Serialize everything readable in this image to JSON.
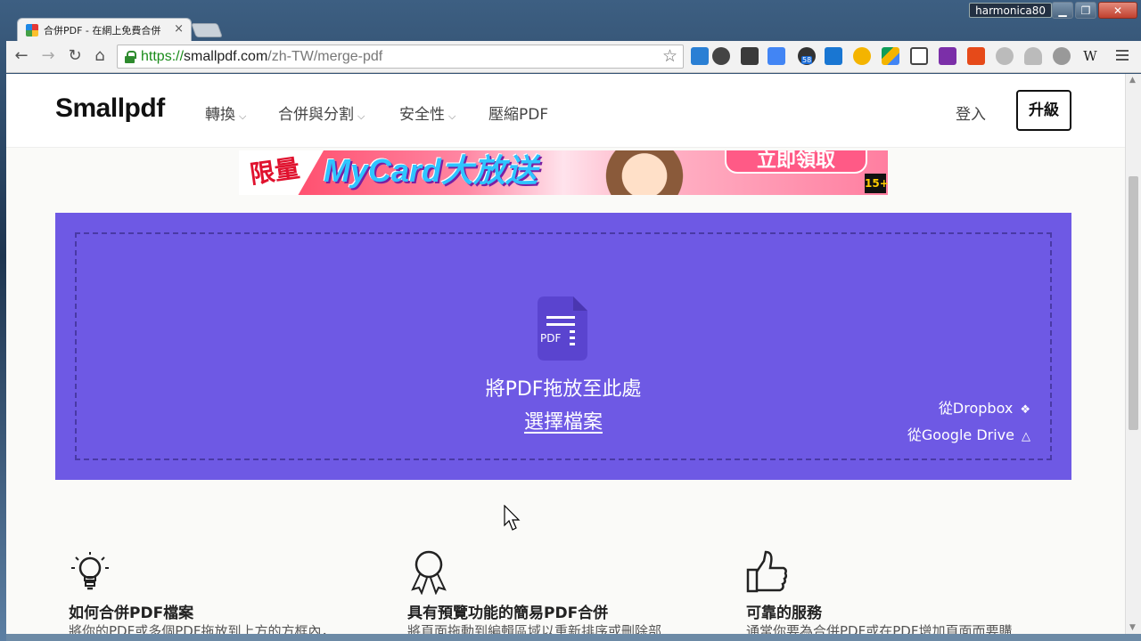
{
  "window": {
    "user": "harmonica80",
    "minimize": "▁",
    "maximize": "❐",
    "close": "✕"
  },
  "tab": {
    "title": "合併PDF - 在網上免費合併",
    "close": "×"
  },
  "toolbar": {
    "back": "←",
    "forward": "→",
    "reload": "↻",
    "home": "⌂",
    "url_scheme": "https://",
    "url_host": "smallpdf.com",
    "url_path": "/zh-TW/merge-pdf",
    "bookmark": "☆",
    "extension_icons": [
      "weather-icon",
      "print-icon",
      "evernote-icon",
      "translate-icon",
      "moon-icon",
      "cloud-icon",
      "star-badge-icon",
      "google-drive-icon",
      "grid-icon",
      "onenote-icon",
      "office-icon",
      "pin-icon",
      "cloud-gray-icon",
      "compass-icon",
      "wikipedia-icon"
    ],
    "badge": "58",
    "wiki": "W"
  },
  "header": {
    "logo": "Smallpdf",
    "nav": [
      {
        "label": "轉換",
        "has_dropdown": true
      },
      {
        "label": "合併與分割",
        "has_dropdown": true
      },
      {
        "label": "安全性",
        "has_dropdown": true
      },
      {
        "label": "壓縮PDF",
        "has_dropdown": false
      }
    ],
    "chevron": "⌵",
    "login": "登入",
    "upgrade": "升級"
  },
  "ad": {
    "left_text": "限量",
    "main_text": "MyCard大放送",
    "button_text": "立即領取",
    "rating": "15+"
  },
  "dropzone": {
    "pdf_label": "PDF",
    "title": "將PDF拖放至此處",
    "choose_file": "選擇檔案",
    "from_dropbox": "從Dropbox",
    "from_gdrive": "從Google Drive",
    "color": "#6e59e4"
  },
  "features": [
    {
      "icon": "lightbulb-icon",
      "title": "如何合併PDF檔案",
      "desc": "將你的PDF或多個PDF拖放到上方的方框內，"
    },
    {
      "icon": "award-ribbon-icon",
      "title": "具有預覽功能的簡易PDF合併",
      "desc": "將頁面拖動到編輯區域以重新排序或刪除部"
    },
    {
      "icon": "thumbs-up-icon",
      "title": "可靠的服務",
      "desc": "通常你要為合併PDF或在PDF增加頁面而要購"
    }
  ]
}
